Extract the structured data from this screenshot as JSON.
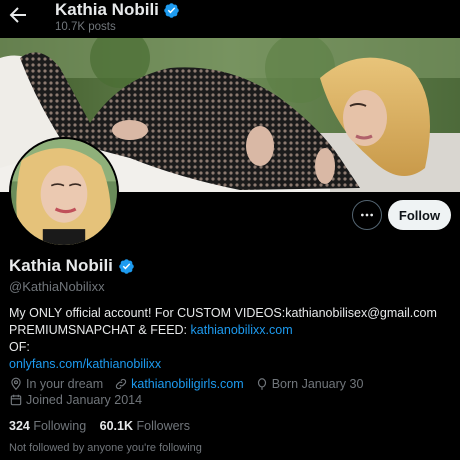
{
  "header": {
    "title": "Kathia Nobili",
    "posts": "10.7K posts"
  },
  "actions": {
    "follow_label": "Follow"
  },
  "profile": {
    "name": "Kathia Nobili",
    "handle": "@KathiaNobilixx",
    "bio": {
      "line1": "My ONLY official account! For CUSTOM VIDEOS:kathianobilisex@gmail.com",
      "line2_text": "PREMIUMSNAPCHAT & FEED: ",
      "line2_link": "kathianobilixx.com",
      "line3": "OF:",
      "line4_link": "onlyfans.com/kathianobilixx"
    },
    "location": "In your dream",
    "website": "kathianobiligirls.com",
    "born": "Born January 30",
    "joined": "Joined January 2014",
    "following_count": "324",
    "following_label": "Following",
    "followers_count": "60.1K",
    "followers_label": "Followers",
    "not_followed": "Not followed by anyone you're following"
  },
  "colors": {
    "accent": "#1d9bf0",
    "background": "#000000",
    "text": "#e7e9ea",
    "muted": "#71767b"
  },
  "icons": [
    "back-arrow-icon",
    "verified-badge-icon",
    "more-icon",
    "location-icon",
    "link-icon",
    "birthday-icon",
    "calendar-icon"
  ]
}
